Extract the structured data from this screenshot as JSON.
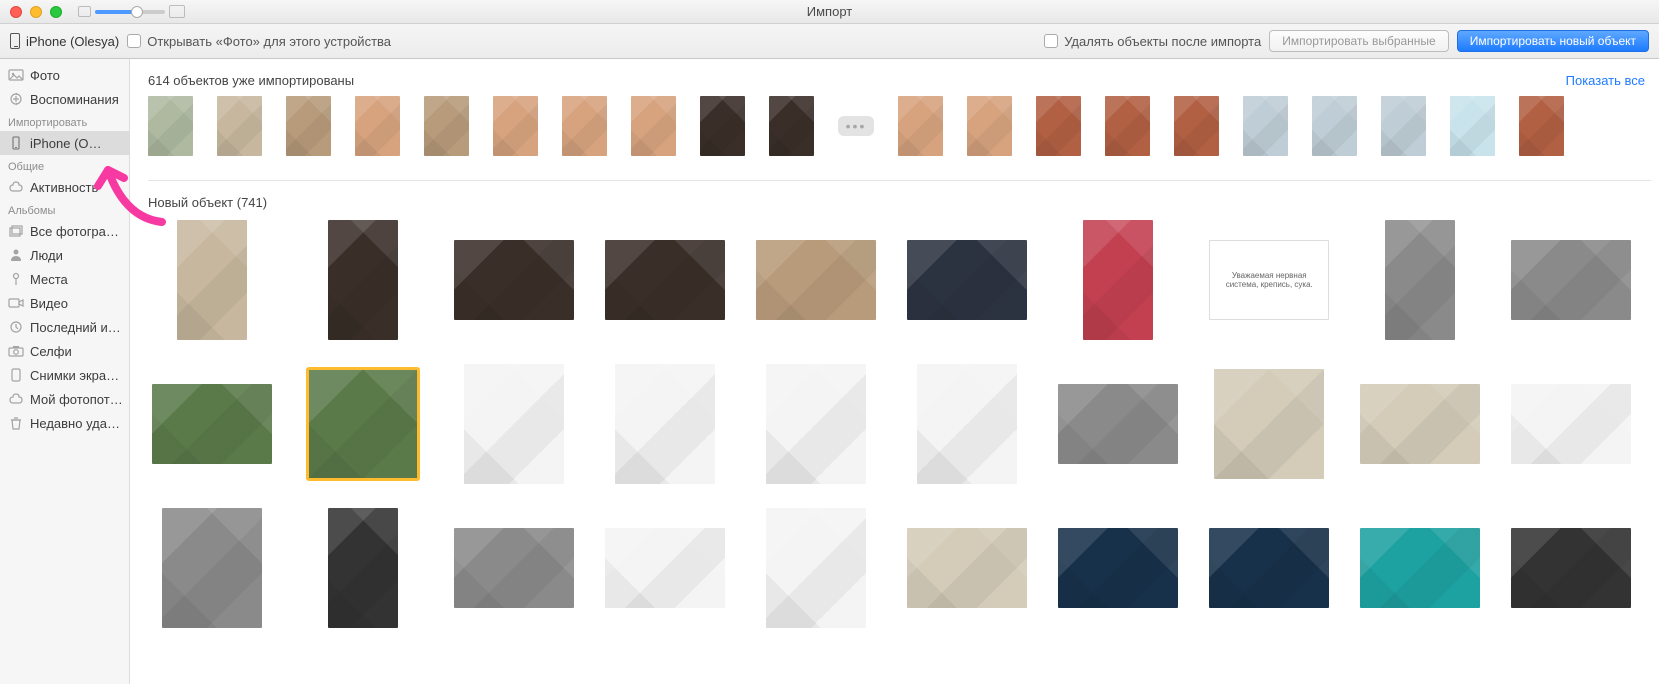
{
  "titlebar": {
    "title": "Импорт"
  },
  "toolbar": {
    "device_name": "iPhone (Olesya)",
    "open_photos_label": "Открывать «Фото» для этого устройства",
    "delete_after_label": "Удалять объекты после импорта",
    "import_selected_label": "Импортировать выбранные",
    "import_new_label": "Импортировать новый объект"
  },
  "sidebar": {
    "sections": {
      "library": {
        "items": [
          "Фото",
          "Воспоминания"
        ]
      },
      "import_title": "Импортировать",
      "import_item": "iPhone (O…",
      "shared_title": "Общие",
      "shared_items": [
        "Активность"
      ],
      "albums_title": "Альбомы",
      "albums_items": [
        "Все фотогра…",
        "Люди",
        "Места",
        "Видео",
        "Последний и…",
        "Селфи",
        "Снимки экра…",
        "Мой фотопот…",
        "Недавно уда…"
      ]
    }
  },
  "main": {
    "imported_title": "614 объектов уже импортированы",
    "show_all": "Показать все",
    "new_title": "Новый объект (741)",
    "quote1": "Уважаемая нервная система, крепись, сука."
  },
  "colors": {
    "accent": "#1e7bff",
    "annotation": "#f63aa2"
  }
}
